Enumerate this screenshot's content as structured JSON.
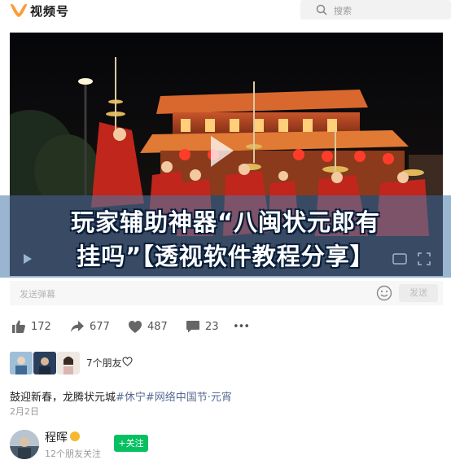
{
  "header": {
    "logo_text": "视频号",
    "search_placeholder": "搜索"
  },
  "video": {
    "caption_line1": "玩家辅助神器“八闽状元郎有",
    "caption_line2": "挂吗”【透视软件教程分享】"
  },
  "danmu": {
    "placeholder": "发送弹幕",
    "send_label": "发送"
  },
  "actions": {
    "like_count": "172",
    "share_count": "677",
    "favorite_count": "487",
    "comment_count": "23",
    "more": "•••"
  },
  "friends": {
    "text": "7个朋友"
  },
  "post": {
    "text_prefix": "鼓迎新春，龙腾状元城",
    "tags": "#休宁#网络中国节·元宵",
    "date": "2月2日"
  },
  "author": {
    "name": "程晖",
    "followers_text": "12个朋友关注",
    "follow_label": "+关注"
  },
  "colors": {
    "accent_green": "#07c160",
    "tag_blue": "#576b95",
    "caption_band": "#4678aa"
  }
}
